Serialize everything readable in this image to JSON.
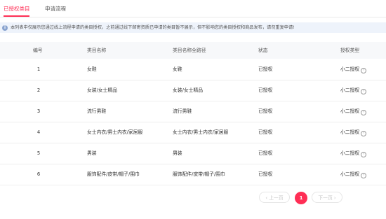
{
  "tabs": [
    {
      "label": "已授权类目",
      "active": true
    },
    {
      "label": "申请流程",
      "active": false
    }
  ],
  "notice": {
    "icon": "info-icon",
    "text": "本列表中仅展示您通过线上流程申请的类目授权，之前通过线下邮寄资质已申请的类目暂不展示，但不影响您的类目授权和商品发布，请勿重复申请!"
  },
  "table": {
    "headers": [
      "编号",
      "类目名称",
      "类目名称全路径",
      "状态",
      "授权类型"
    ],
    "rows": [
      {
        "id": "1",
        "name": "女鞋",
        "path": "女鞋",
        "status": "已授权",
        "auth_type": "小二授权"
      },
      {
        "id": "2",
        "name": "女装/女士精品",
        "path": "女装/女士精品",
        "status": "已授权",
        "auth_type": "小二授权"
      },
      {
        "id": "3",
        "name": "流行男鞋",
        "path": "流行男鞋",
        "status": "已授权",
        "auth_type": "小二授权"
      },
      {
        "id": "4",
        "name": "女士内衣/男士内衣/家居服",
        "path": "女士内衣/男士内衣/家居服",
        "status": "已授权",
        "auth_type": "小二授权"
      },
      {
        "id": "5",
        "name": "男装",
        "path": "男装",
        "status": "已授权",
        "auth_type": "小二授权"
      },
      {
        "id": "6",
        "name": "服饰配件/皮带/帽子/围巾",
        "path": "服饰配件/皮带/帽子/围巾",
        "status": "已授权",
        "auth_type": "小二授权"
      }
    ]
  },
  "pagination": {
    "prev_label": "‹ 上一页",
    "current_page": "1",
    "next_label": "下一页 ›"
  },
  "colors": {
    "accent": "#ff2e55",
    "notice_bg": "#eef3fb",
    "header_bg": "#f7f8fa"
  }
}
